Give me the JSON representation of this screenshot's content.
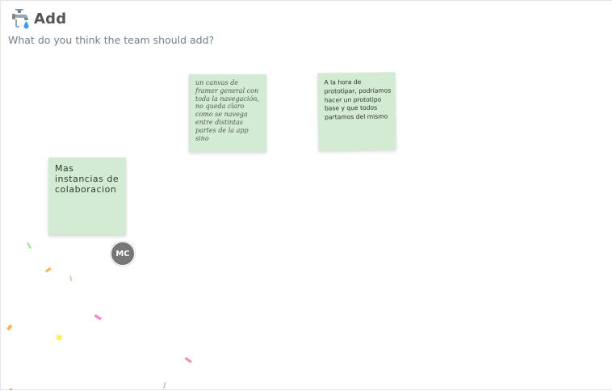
{
  "section": {
    "icon": "faucet-icon",
    "title": "Add",
    "prompt": "What do you think the team should add?"
  },
  "notes": [
    {
      "text": "un canvas de framer general con toda la navegación, no queda claro como se navega entre distintas partes de la app sino",
      "color": "#d3ebd3"
    },
    {
      "text": "A la hora de prototipar, podríamos hacer un prototipo base y que todos partamos del mismo",
      "color": "#d3ebd3"
    },
    {
      "text": "Mas instancias de colaboracion",
      "color": "#d3ebd3"
    }
  ],
  "participant": {
    "initials": "MC",
    "color": "#767676"
  },
  "confetti_colors": [
    "#9be38f",
    "#ffb24d",
    "#ff7ad9",
    "#fff24d",
    "#ff8a9c",
    "#b9b9b9"
  ]
}
